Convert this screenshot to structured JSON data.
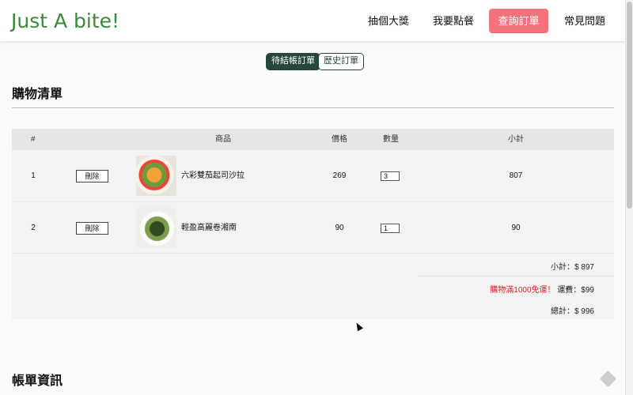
{
  "brand": "Just A bite!",
  "nav": {
    "lottery": "抽個大獎",
    "order": "我要點餐",
    "query": "查詢訂單",
    "faq": "常見問題"
  },
  "tabs": {
    "pending": "待結帳訂單",
    "history": "歷史訂單"
  },
  "cart": {
    "title": "購物清單",
    "headers": {
      "num": "#",
      "product": "商品",
      "price": "價格",
      "qty": "數量",
      "subtotal": "小計"
    },
    "rows": [
      {
        "num": "1",
        "delete": "刪除",
        "name": "六彩雙茄起司沙拉",
        "price": "269",
        "qty": "3",
        "subtotal": "807"
      },
      {
        "num": "2",
        "delete": "刪除",
        "name": "輕盈高麗卷湘南",
        "price": "90",
        "qty": "1",
        "subtotal": "90"
      }
    ],
    "summary": {
      "subtotal": "小計：$ 897",
      "promo": "購物滿1000免運！",
      "shipping": "運費：$99",
      "total": "總計：$ 996"
    }
  },
  "billing": {
    "title": "帳單資訊"
  },
  "colors": {
    "brand": "#3b8a3b",
    "active_nav": "#f4727e",
    "tab_dark": "#26473a",
    "promo": "#e0202e"
  }
}
